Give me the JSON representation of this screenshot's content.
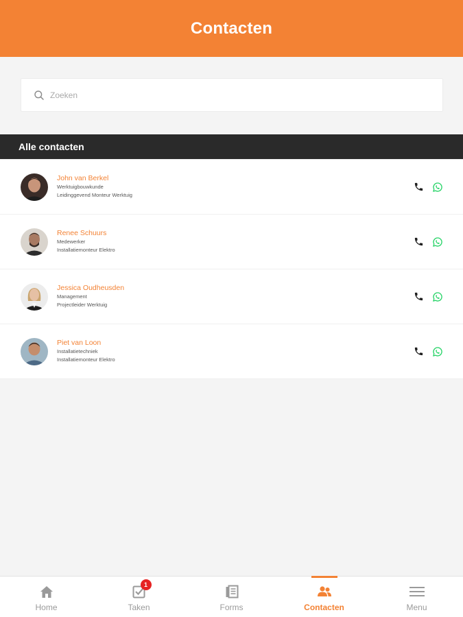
{
  "header": {
    "title": "Contacten"
  },
  "search": {
    "placeholder": "Zoeken",
    "value": ""
  },
  "section": {
    "title": "Alle contacten"
  },
  "contacts": [
    {
      "name": "John van Berkel",
      "role": "Werktuigbouwkunde",
      "title": "Leidinggevend Monteur Werktuig"
    },
    {
      "name": "Renee Schuurs",
      "role": "Medewerker",
      "title": "Installatiemonteur Elektro"
    },
    {
      "name": "Jessica Oudheusden",
      "role": "Management",
      "title": "Projectleider Werktuig"
    },
    {
      "name": "Piet van Loon",
      "role": "Installatietechniek",
      "title": "Installatiemonteur Elektro"
    }
  ],
  "nav": {
    "home": "Home",
    "tasks": "Taken",
    "tasks_badge": "1",
    "forms": "Forms",
    "contacts": "Contacten",
    "menu": "Menu",
    "active": "contacts"
  },
  "colors": {
    "accent": "#f38234",
    "header_bar": "#2a2a2a",
    "whatsapp": "#25d366",
    "badge": "#e62323"
  }
}
